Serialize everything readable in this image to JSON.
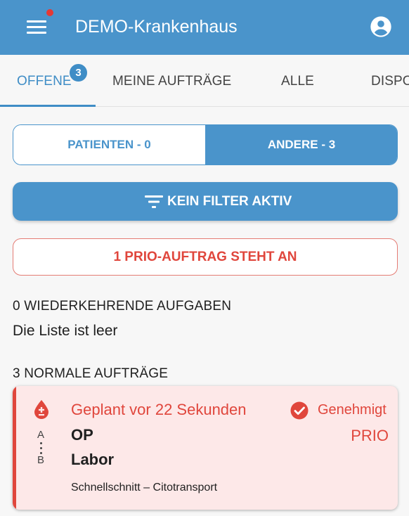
{
  "appbar": {
    "title": "DEMO-Krankenhaus",
    "menu_icon": "menu-icon",
    "account_icon": "account-circle-icon",
    "notification_dot_color": "#e53935"
  },
  "tabs": [
    {
      "label": "OFFENE",
      "active": true,
      "badge": "3"
    },
    {
      "label": "MEINE AUFTRÄGE",
      "active": false
    },
    {
      "label": "ALLE",
      "active": false
    },
    {
      "label": "DISPO",
      "active": false
    }
  ],
  "segment": {
    "left_label": "PATIENTEN - 0",
    "right_label": "ANDERE - 3",
    "selected": "right"
  },
  "filter_button": {
    "label": "KEIN FILTER AKTIV",
    "icon": "filter-list-icon"
  },
  "prio_banner": {
    "label": "1 PRIO-AUFTRAG STEHT AN"
  },
  "recurring": {
    "title": "0 WIEDERKEHRENDE AUFGABEN",
    "empty_text": "Die Liste ist leer"
  },
  "normal": {
    "title": "3 NORMALE AUFTRÄGE",
    "orders": [
      {
        "time": "Geplant vor 22 Sekunden",
        "status": "Genehmigt",
        "priority": "PRIO",
        "route_start": "A",
        "route_end": "B",
        "from": "OP",
        "to": "Labor",
        "description": "Schnellschnitt – Citotransport",
        "icon": "blood-drop-icon",
        "status_icon": "check-circle-icon"
      }
    ]
  },
  "colors": {
    "primary": "#4a94cb",
    "accent": "#3f8dc6",
    "danger": "#e0463c",
    "card_bg": "#fde8e8"
  }
}
